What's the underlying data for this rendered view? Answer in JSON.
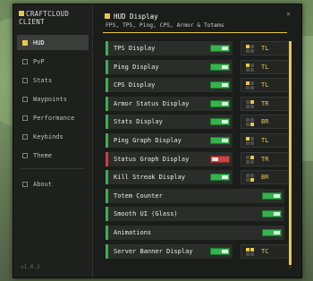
{
  "sidebar": {
    "brand_line1": "CRAFTCLOUD",
    "brand_line2": "CLIENT",
    "items": [
      {
        "label": "HUD"
      },
      {
        "label": "PvP"
      },
      {
        "label": "Stats"
      },
      {
        "label": "Waypoints"
      },
      {
        "label": "Performance"
      },
      {
        "label": "Keybinds"
      },
      {
        "label": "Theme"
      },
      {
        "label": "About"
      }
    ],
    "version": "v1.0.2"
  },
  "header": {
    "title": "HUD Display",
    "subtitle": "FPS, TPS, Ping, CPS, Armor & Totems",
    "close": "×"
  },
  "colors": {
    "accent": "#e8c84a",
    "on": "#37b24d",
    "off": "#d63a3a"
  },
  "modules": [
    {
      "label": "TPS Display",
      "enabled": true,
      "position": "TL"
    },
    {
      "label": "Ping Display",
      "enabled": true,
      "position": "TL"
    },
    {
      "label": "CPS Display",
      "enabled": true,
      "position": "TL"
    },
    {
      "label": "Armor Status Display",
      "enabled": true,
      "position": "TR"
    },
    {
      "label": "Stats Display",
      "enabled": true,
      "position": "BR"
    },
    {
      "label": "Ping Graph Display",
      "enabled": true,
      "position": "TL"
    },
    {
      "label": "Status Graph Display",
      "enabled": false,
      "position": "TR"
    },
    {
      "label": "Kill Streak Display",
      "enabled": true,
      "position": "BR"
    },
    {
      "label": "Totem Counter",
      "enabled": true,
      "position": ""
    },
    {
      "label": "Smooth UI (Glass)",
      "enabled": true,
      "position": ""
    },
    {
      "label": "Animations",
      "enabled": true,
      "position": ""
    },
    {
      "label": "Server Banner Display",
      "enabled": true,
      "position": "TC"
    }
  ]
}
